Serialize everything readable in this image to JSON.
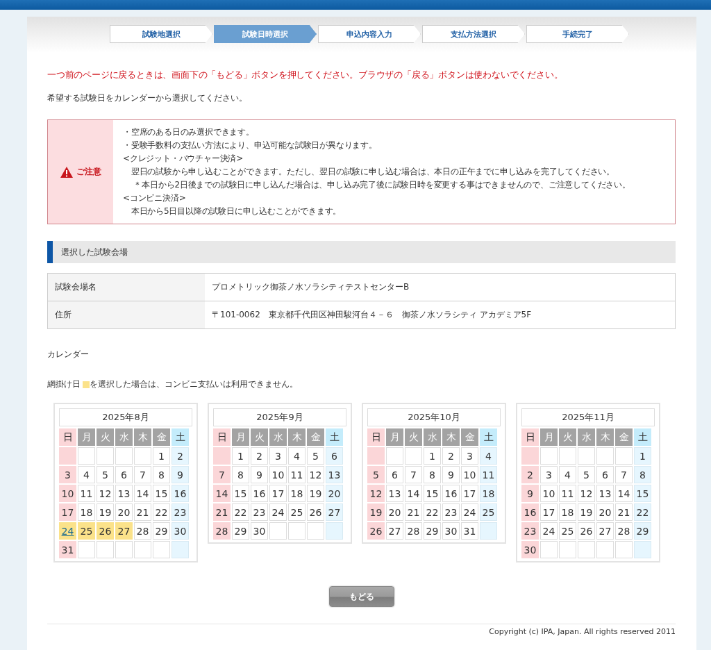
{
  "steps": [
    {
      "label": "試験地選択",
      "selected": false
    },
    {
      "label": "試験日時選択",
      "selected": true
    },
    {
      "label": "申込内容入力",
      "selected": false
    },
    {
      "label": "支払方法選択",
      "selected": false
    },
    {
      "label": "手続完了",
      "selected": false
    }
  ],
  "warning_message": "一つ前のページに戻るときは、画面下の「もどる」ボタンを押してください。ブラウザの「戻る」ボタンは使わないでください。",
  "instruction": "希望する試験日をカレンダーから選択してください。",
  "notice": {
    "label": "ご注意",
    "lines": [
      "・空席のある日のみ選択できます。",
      "・受験手数料の支払い方法により、申込可能な試験日が異なります。",
      "<クレジット・バウチャー決済>",
      "　翌日の試験から申し込むことができます。ただし、翌日の試験に申し込む場合は、本日の正午までに申し込みを完了してください。",
      "　 ＊本日から2日後までの試験日に申し込んだ場合は、申し込み完了後に試験日時を変更する事はできませんので、ご注意してください。",
      "<コンビニ決済>",
      "　本日から5日目以降の試験日に申し込むことができます。"
    ]
  },
  "venue_section": {
    "title": "選択した試験会場",
    "rows": [
      {
        "label": "試験会場名",
        "value": "プロメトリック御茶ノ水ソラシティテストセンターB"
      },
      {
        "label": "住所",
        "value": "〒101-0062　東京都千代田区神田駿河台４－６　御茶ノ水ソラシティ アカデミア5F"
      }
    ]
  },
  "calendar_label": "カレンダー",
  "legend": {
    "before": "網掛け日",
    "after": "を選択した場合は、コンビニ支払いは利用できません。"
  },
  "months": [
    {
      "title": "2025年8月",
      "weekdays": [
        "日",
        "月",
        "火",
        "水",
        "木",
        "金",
        "土"
      ],
      "weeks": [
        [
          {
            "kind": "blank"
          },
          {
            "kind": "blank"
          },
          {
            "kind": "blank"
          },
          {
            "kind": "blank"
          },
          {
            "kind": "blank"
          },
          {
            "kind": "day",
            "d": "1",
            "hatched": false,
            "available": false
          },
          {
            "kind": "day",
            "d": "2",
            "hatched": false,
            "available": false
          }
        ],
        [
          {
            "kind": "day",
            "d": "3",
            "hatched": false,
            "available": false
          },
          {
            "kind": "day",
            "d": "4",
            "hatched": false,
            "available": false
          },
          {
            "kind": "day",
            "d": "5",
            "hatched": false,
            "available": false
          },
          {
            "kind": "day",
            "d": "6",
            "hatched": false,
            "available": false
          },
          {
            "kind": "day",
            "d": "7",
            "hatched": false,
            "available": false
          },
          {
            "kind": "day",
            "d": "8",
            "hatched": false,
            "available": false
          },
          {
            "kind": "day",
            "d": "9",
            "hatched": false,
            "available": false
          }
        ],
        [
          {
            "kind": "day",
            "d": "10",
            "hatched": false,
            "available": false
          },
          {
            "kind": "day",
            "d": "11",
            "hatched": false,
            "available": false
          },
          {
            "kind": "day",
            "d": "12",
            "hatched": false,
            "available": false
          },
          {
            "kind": "day",
            "d": "13",
            "hatched": false,
            "available": false
          },
          {
            "kind": "day",
            "d": "14",
            "hatched": false,
            "available": false
          },
          {
            "kind": "day",
            "d": "15",
            "hatched": false,
            "available": false
          },
          {
            "kind": "day",
            "d": "16",
            "hatched": false,
            "available": false
          }
        ],
        [
          {
            "kind": "day",
            "d": "17",
            "hatched": false,
            "available": false
          },
          {
            "kind": "day",
            "d": "18",
            "hatched": false,
            "available": false
          },
          {
            "kind": "day",
            "d": "19",
            "hatched": false,
            "available": false
          },
          {
            "kind": "day",
            "d": "20",
            "hatched": false,
            "available": false
          },
          {
            "kind": "day",
            "d": "21",
            "hatched": false,
            "available": false
          },
          {
            "kind": "day",
            "d": "22",
            "hatched": false,
            "available": false
          },
          {
            "kind": "day",
            "d": "23",
            "hatched": false,
            "available": false
          }
        ],
        [
          {
            "kind": "day",
            "d": "24",
            "hatched": true,
            "available": true
          },
          {
            "kind": "day",
            "d": "25",
            "hatched": true,
            "available": false
          },
          {
            "kind": "day",
            "d": "26",
            "hatched": true,
            "available": false
          },
          {
            "kind": "day",
            "d": "27",
            "hatched": true,
            "available": false
          },
          {
            "kind": "day",
            "d": "28",
            "hatched": false,
            "available": false
          },
          {
            "kind": "day",
            "d": "29",
            "hatched": false,
            "available": false
          },
          {
            "kind": "day",
            "d": "30",
            "hatched": false,
            "available": false
          }
        ],
        [
          {
            "kind": "day",
            "d": "31",
            "hatched": false,
            "available": false
          },
          {
            "kind": "blank"
          },
          {
            "kind": "blank"
          },
          {
            "kind": "blank"
          },
          {
            "kind": "blank"
          },
          {
            "kind": "blank"
          },
          {
            "kind": "blank"
          }
        ]
      ]
    },
    {
      "title": "2025年9月",
      "weekdays": [
        "日",
        "月",
        "火",
        "水",
        "木",
        "金",
        "土"
      ],
      "weeks": [
        [
          {
            "kind": "blank"
          },
          {
            "kind": "day",
            "d": "1",
            "hatched": false,
            "available": false
          },
          {
            "kind": "day",
            "d": "2",
            "hatched": false,
            "available": false
          },
          {
            "kind": "day",
            "d": "3",
            "hatched": false,
            "available": false
          },
          {
            "kind": "day",
            "d": "4",
            "hatched": false,
            "available": false
          },
          {
            "kind": "day",
            "d": "5",
            "hatched": false,
            "available": false
          },
          {
            "kind": "day",
            "d": "6",
            "hatched": false,
            "available": false
          }
        ],
        [
          {
            "kind": "day",
            "d": "7",
            "hatched": false,
            "available": false
          },
          {
            "kind": "day",
            "d": "8",
            "hatched": false,
            "available": false
          },
          {
            "kind": "day",
            "d": "9",
            "hatched": false,
            "available": false
          },
          {
            "kind": "day",
            "d": "10",
            "hatched": false,
            "available": false
          },
          {
            "kind": "day",
            "d": "11",
            "hatched": false,
            "available": false
          },
          {
            "kind": "day",
            "d": "12",
            "hatched": false,
            "available": false
          },
          {
            "kind": "day",
            "d": "13",
            "hatched": false,
            "available": false
          }
        ],
        [
          {
            "kind": "day",
            "d": "14",
            "hatched": false,
            "available": false
          },
          {
            "kind": "day",
            "d": "15",
            "hatched": false,
            "available": false
          },
          {
            "kind": "day",
            "d": "16",
            "hatched": false,
            "available": false
          },
          {
            "kind": "day",
            "d": "17",
            "hatched": false,
            "available": false
          },
          {
            "kind": "day",
            "d": "18",
            "hatched": false,
            "available": false
          },
          {
            "kind": "day",
            "d": "19",
            "hatched": false,
            "available": false
          },
          {
            "kind": "day",
            "d": "20",
            "hatched": false,
            "available": false
          }
        ],
        [
          {
            "kind": "day",
            "d": "21",
            "hatched": false,
            "available": false
          },
          {
            "kind": "day",
            "d": "22",
            "hatched": false,
            "available": false
          },
          {
            "kind": "day",
            "d": "23",
            "hatched": false,
            "available": false
          },
          {
            "kind": "day",
            "d": "24",
            "hatched": false,
            "available": false
          },
          {
            "kind": "day",
            "d": "25",
            "hatched": false,
            "available": false
          },
          {
            "kind": "day",
            "d": "26",
            "hatched": false,
            "available": false
          },
          {
            "kind": "day",
            "d": "27",
            "hatched": false,
            "available": false
          }
        ],
        [
          {
            "kind": "day",
            "d": "28",
            "hatched": false,
            "available": false
          },
          {
            "kind": "day",
            "d": "29",
            "hatched": false,
            "available": false
          },
          {
            "kind": "day",
            "d": "30",
            "hatched": false,
            "available": false
          },
          {
            "kind": "blank"
          },
          {
            "kind": "blank"
          },
          {
            "kind": "blank"
          },
          {
            "kind": "blank"
          }
        ]
      ]
    },
    {
      "title": "2025年10月",
      "weekdays": [
        "日",
        "月",
        "火",
        "水",
        "木",
        "金",
        "土"
      ],
      "weeks": [
        [
          {
            "kind": "blank"
          },
          {
            "kind": "blank"
          },
          {
            "kind": "blank"
          },
          {
            "kind": "day",
            "d": "1",
            "hatched": false,
            "available": false
          },
          {
            "kind": "day",
            "d": "2",
            "hatched": false,
            "available": false
          },
          {
            "kind": "day",
            "d": "3",
            "hatched": false,
            "available": false
          },
          {
            "kind": "day",
            "d": "4",
            "hatched": false,
            "available": false
          }
        ],
        [
          {
            "kind": "day",
            "d": "5",
            "hatched": false,
            "available": false
          },
          {
            "kind": "day",
            "d": "6",
            "hatched": false,
            "available": false
          },
          {
            "kind": "day",
            "d": "7",
            "hatched": false,
            "available": false
          },
          {
            "kind": "day",
            "d": "8",
            "hatched": false,
            "available": false
          },
          {
            "kind": "day",
            "d": "9",
            "hatched": false,
            "available": false
          },
          {
            "kind": "day",
            "d": "10",
            "hatched": false,
            "available": false
          },
          {
            "kind": "day",
            "d": "11",
            "hatched": false,
            "available": false
          }
        ],
        [
          {
            "kind": "day",
            "d": "12",
            "hatched": false,
            "available": false
          },
          {
            "kind": "day",
            "d": "13",
            "hatched": false,
            "available": false
          },
          {
            "kind": "day",
            "d": "14",
            "hatched": false,
            "available": false
          },
          {
            "kind": "day",
            "d": "15",
            "hatched": false,
            "available": false
          },
          {
            "kind": "day",
            "d": "16",
            "hatched": false,
            "available": false
          },
          {
            "kind": "day",
            "d": "17",
            "hatched": false,
            "available": false
          },
          {
            "kind": "day",
            "d": "18",
            "hatched": false,
            "available": false
          }
        ],
        [
          {
            "kind": "day",
            "d": "19",
            "hatched": false,
            "available": false
          },
          {
            "kind": "day",
            "d": "20",
            "hatched": false,
            "available": false
          },
          {
            "kind": "day",
            "d": "21",
            "hatched": false,
            "available": false
          },
          {
            "kind": "day",
            "d": "22",
            "hatched": false,
            "available": false
          },
          {
            "kind": "day",
            "d": "23",
            "hatched": false,
            "available": false
          },
          {
            "kind": "day",
            "d": "24",
            "hatched": false,
            "available": false
          },
          {
            "kind": "day",
            "d": "25",
            "hatched": false,
            "available": false
          }
        ],
        [
          {
            "kind": "day",
            "d": "26",
            "hatched": false,
            "available": false
          },
          {
            "kind": "day",
            "d": "27",
            "hatched": false,
            "available": false
          },
          {
            "kind": "day",
            "d": "28",
            "hatched": false,
            "available": false
          },
          {
            "kind": "day",
            "d": "29",
            "hatched": false,
            "available": false
          },
          {
            "kind": "day",
            "d": "30",
            "hatched": false,
            "available": false
          },
          {
            "kind": "day",
            "d": "31",
            "hatched": false,
            "available": false
          },
          {
            "kind": "blank"
          }
        ]
      ]
    },
    {
      "title": "2025年11月",
      "weekdays": [
        "日",
        "月",
        "火",
        "水",
        "木",
        "金",
        "土"
      ],
      "weeks": [
        [
          {
            "kind": "blank"
          },
          {
            "kind": "blank"
          },
          {
            "kind": "blank"
          },
          {
            "kind": "blank"
          },
          {
            "kind": "blank"
          },
          {
            "kind": "blank"
          },
          {
            "kind": "day",
            "d": "1",
            "hatched": false,
            "available": false
          }
        ],
        [
          {
            "kind": "day",
            "d": "2",
            "hatched": false,
            "available": false
          },
          {
            "kind": "day",
            "d": "3",
            "hatched": false,
            "available": false
          },
          {
            "kind": "day",
            "d": "4",
            "hatched": false,
            "available": false
          },
          {
            "kind": "day",
            "d": "5",
            "hatched": false,
            "available": false
          },
          {
            "kind": "day",
            "d": "6",
            "hatched": false,
            "available": false
          },
          {
            "kind": "day",
            "d": "7",
            "hatched": false,
            "available": false
          },
          {
            "kind": "day",
            "d": "8",
            "hatched": false,
            "available": false
          }
        ],
        [
          {
            "kind": "day",
            "d": "9",
            "hatched": false,
            "available": false
          },
          {
            "kind": "day",
            "d": "10",
            "hatched": false,
            "available": false
          },
          {
            "kind": "day",
            "d": "11",
            "hatched": false,
            "available": false
          },
          {
            "kind": "day",
            "d": "12",
            "hatched": false,
            "available": false
          },
          {
            "kind": "day",
            "d": "13",
            "hatched": false,
            "available": false
          },
          {
            "kind": "day",
            "d": "14",
            "hatched": false,
            "available": false
          },
          {
            "kind": "day",
            "d": "15",
            "hatched": false,
            "available": false
          }
        ],
        [
          {
            "kind": "day",
            "d": "16",
            "hatched": false,
            "available": false
          },
          {
            "kind": "day",
            "d": "17",
            "hatched": false,
            "available": false
          },
          {
            "kind": "day",
            "d": "18",
            "hatched": false,
            "available": false
          },
          {
            "kind": "day",
            "d": "19",
            "hatched": false,
            "available": false
          },
          {
            "kind": "day",
            "d": "20",
            "hatched": false,
            "available": false
          },
          {
            "kind": "day",
            "d": "21",
            "hatched": false,
            "available": false
          },
          {
            "kind": "day",
            "d": "22",
            "hatched": false,
            "available": false
          }
        ],
        [
          {
            "kind": "day",
            "d": "23",
            "hatched": false,
            "available": false
          },
          {
            "kind": "day",
            "d": "24",
            "hatched": false,
            "available": false
          },
          {
            "kind": "day",
            "d": "25",
            "hatched": false,
            "available": false
          },
          {
            "kind": "day",
            "d": "26",
            "hatched": false,
            "available": false
          },
          {
            "kind": "day",
            "d": "27",
            "hatched": false,
            "available": false
          },
          {
            "kind": "day",
            "d": "28",
            "hatched": false,
            "available": false
          },
          {
            "kind": "day",
            "d": "29",
            "hatched": false,
            "available": false
          }
        ],
        [
          {
            "kind": "day",
            "d": "30",
            "hatched": false,
            "available": false
          },
          {
            "kind": "blank"
          },
          {
            "kind": "blank"
          },
          {
            "kind": "blank"
          },
          {
            "kind": "blank"
          },
          {
            "kind": "blank"
          },
          {
            "kind": "blank"
          }
        ]
      ]
    }
  ],
  "back_button": "もどる",
  "copyright": "Copyright (c) IPA, Japan. All rights reserved 2011"
}
